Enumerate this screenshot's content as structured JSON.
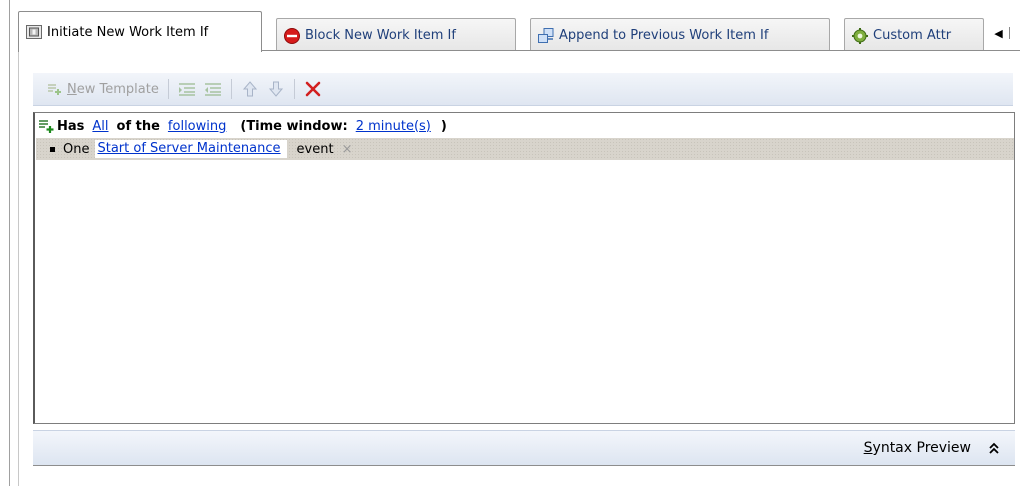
{
  "tabs": [
    {
      "label": "Initiate New Work Item If",
      "icon": "work-item-icon",
      "active": true
    },
    {
      "label": "Block New Work Item If",
      "icon": "block-icon",
      "active": false
    },
    {
      "label": "Append to Previous Work Item If",
      "icon": "append-icon",
      "active": false
    },
    {
      "label": "Custom Attr",
      "icon": "gear-icon",
      "active": false
    }
  ],
  "toolbar": {
    "new_template_label": "New Template",
    "new_template_mnemonic": "N",
    "new_template_rest": "ew Template"
  },
  "rule": {
    "has": "Has",
    "quantifier": "All",
    "of_the": "of the",
    "following": "following",
    "time_window_label": "(Time window:",
    "time_window_value": "2 minute(s)",
    "close_paren": ")"
  },
  "condition": {
    "count": "One",
    "event_name": "Start of Server Maintenance",
    "suffix": "event",
    "remove": "×"
  },
  "syntax_preview": {
    "label": "Syntax Preview",
    "mnemonic": "S",
    "rest": "yntax Preview"
  },
  "colors": {
    "link": "#0033cc",
    "delete_red": "#d21f1f",
    "block_red": "#d61a1a",
    "condition_row_bg": "#d8d4cc"
  }
}
